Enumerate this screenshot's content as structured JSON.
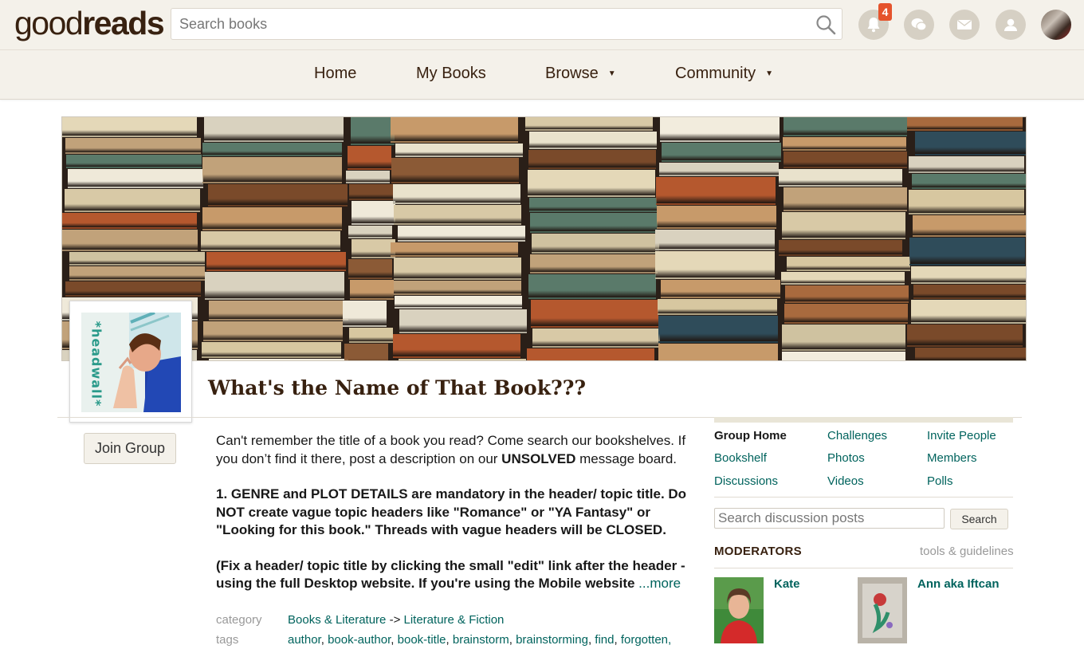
{
  "header": {
    "logo_good": "good",
    "logo_reads": "reads",
    "search_placeholder": "Search books",
    "notification_count": "4",
    "icons": [
      "notifications-icon",
      "discussions-icon",
      "messages-icon",
      "friends-icon",
      "profile-avatar"
    ]
  },
  "nav": {
    "items": [
      {
        "label": "Home",
        "dropdown": false
      },
      {
        "label": "My Books",
        "dropdown": false
      },
      {
        "label": "Browse",
        "dropdown": true
      },
      {
        "label": "Community",
        "dropdown": true
      }
    ],
    "caret": "▼"
  },
  "group": {
    "title": "What's the Name of That Book???",
    "photo_text": "*headwall*",
    "join_label": "Join Group",
    "description": {
      "p1_a": "Can't remember the title of a book you read? Come search our bookshelves. If you don’t find it there, post a description on our ",
      "p1_b": "UNSOLVED",
      "p1_c": " message board.",
      "p2": "1. GENRE and PLOT DETAILS are mandatory in the header/ topic title. Do NOT create vague topic headers like \"Romance\" or \"YA Fantasy\" or \"Looking for this book.\" Threads with vague headers will be CLOSED.",
      "p3": "(Fix a header/ topic title by clicking the small \"edit\" link after the header - using the full Desktop website. If you're using the Mobile website ",
      "more": "...more"
    },
    "category_label": "category",
    "category_1": "Books & Literature",
    "category_sep": " -> ",
    "category_2": "Literature & Fiction",
    "tags_label": "tags",
    "tags": [
      "author",
      "book-author",
      "book-title",
      "brainstorm",
      "brainstorming",
      "find",
      "forgotten,"
    ]
  },
  "panel": {
    "links": [
      [
        "Group Home",
        "Challenges",
        "Invite People"
      ],
      [
        "Bookshelf",
        "Photos",
        "Members"
      ],
      [
        "Discussions",
        "Videos",
        "Polls"
      ]
    ],
    "search_placeholder": "Search discussion posts",
    "search_button": "Search",
    "moderators_title": "MODERATORS",
    "tools_link": "tools & guidelines",
    "moderators": [
      {
        "name": "Kate"
      },
      {
        "name": "Ann aka Iftcan"
      }
    ]
  },
  "colors": {
    "header_bg": "#f4f1ea",
    "brand_brown": "#382110",
    "link_green": "#00635d",
    "badge_red": "#e5532c"
  }
}
